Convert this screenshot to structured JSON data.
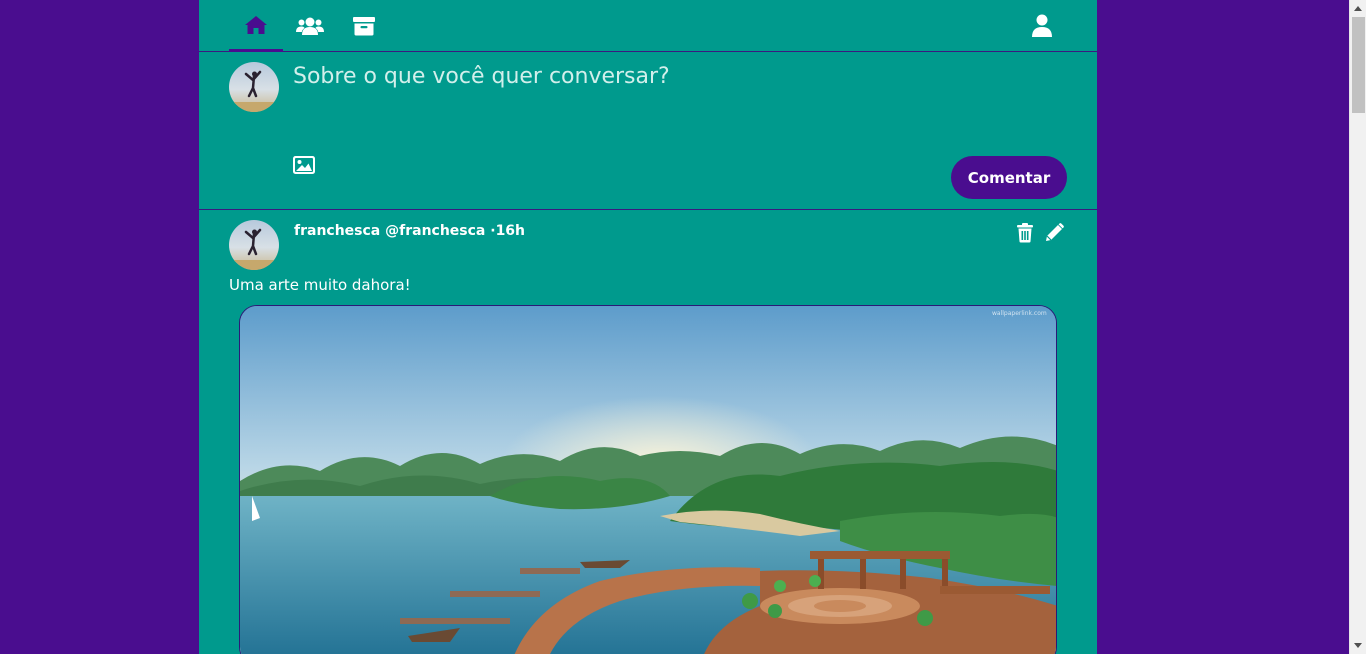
{
  "nav": {
    "items": [
      {
        "icon": "home-icon",
        "active": true
      },
      {
        "icon": "users-icon",
        "active": false
      },
      {
        "icon": "archive-icon",
        "active": false
      }
    ],
    "profile_icon": "user-icon"
  },
  "composer": {
    "placeholder": "Sobre o que você quer conversar?",
    "image_icon": "image-icon",
    "submit_label": "Comentar"
  },
  "post": {
    "name": "franchesca",
    "handle": "@franchesca",
    "time": "·16h",
    "text": "Uma arte muito dahora!",
    "actions": [
      "trash-icon",
      "pencil-icon"
    ],
    "image_watermark": "wallpaperlink.com"
  },
  "colors": {
    "background": "#4a0d8f",
    "panel": "#009a8d",
    "accent": "#4a0d8f",
    "text": "#ffffff"
  }
}
